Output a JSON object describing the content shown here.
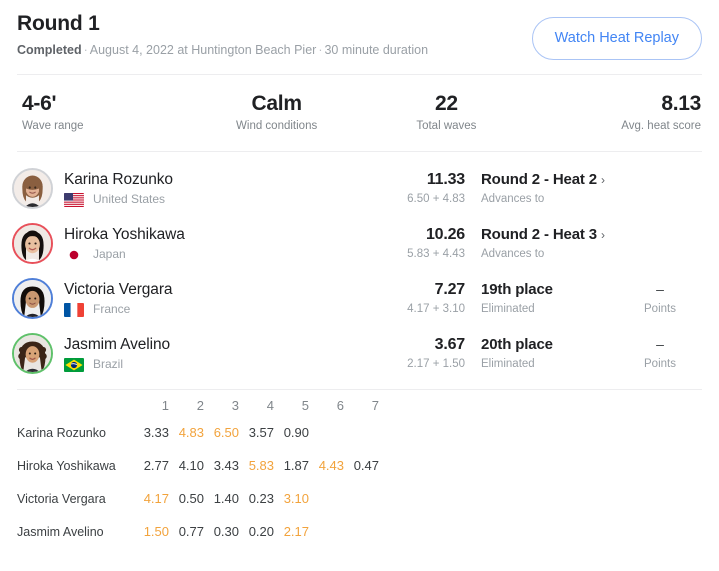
{
  "header": {
    "title": "Round 1",
    "status": "Completed",
    "separator": "·",
    "date_location": "August 4, 2022 at Huntington Beach Pier",
    "duration": "30 minute duration",
    "replay_button": "Watch Heat Replay",
    "accent_color": "#4285f4"
  },
  "stats": [
    {
      "value": "4-6'",
      "label": "Wave range"
    },
    {
      "value": "Calm",
      "label": "Wind conditions"
    },
    {
      "value": "22",
      "label": "Total waves"
    },
    {
      "value": "8.13",
      "label": "Avg. heat score"
    }
  ],
  "athletes": [
    {
      "name": "Karina Rozunko",
      "country": "United States",
      "flag": "us",
      "ring_color": "#d0d2d6",
      "total": "11.33",
      "parts": "6.50 + 4.83",
      "result": "Round 2 - Heat 2",
      "chevron": "›",
      "result_sub": "Advances to",
      "points": null,
      "points_label": null
    },
    {
      "name": "Hiroka Yoshikawa",
      "country": "Japan",
      "flag": "jp",
      "ring_color": "#e8505a",
      "total": "10.26",
      "parts": "5.83 + 4.43",
      "result": "Round 2 - Heat 3",
      "chevron": "›",
      "result_sub": "Advances to",
      "points": null,
      "points_label": null
    },
    {
      "name": "Victoria Vergara",
      "country": "France",
      "flag": "fr",
      "ring_color": "#4f7fd8",
      "total": "7.27",
      "parts": "4.17 + 3.10",
      "result": "19th place",
      "chevron": "",
      "result_sub": "Eliminated",
      "points": "–",
      "points_label": "Points"
    },
    {
      "name": "Jasmim Avelino",
      "country": "Brazil",
      "flag": "br",
      "ring_color": "#5fc16a",
      "total": "3.67",
      "parts": "2.17 + 1.50",
      "result": "20th place",
      "chevron": "",
      "result_sub": "Eliminated",
      "points": "–",
      "points_label": "Points"
    }
  ],
  "waves_table": {
    "name_header": "",
    "columns": [
      "1",
      "2",
      "3",
      "4",
      "5",
      "6",
      "7"
    ],
    "highlight_color": "#f2a33c",
    "rows": [
      {
        "athlete": "Karina Rozunko",
        "scores": [
          "3.33",
          "4.83",
          "6.50",
          "3.57",
          "0.90",
          "",
          ""
        ],
        "highlights": [
          false,
          true,
          true,
          false,
          false,
          false,
          false
        ]
      },
      {
        "athlete": "Hiroka Yoshikawa",
        "scores": [
          "2.77",
          "4.10",
          "3.43",
          "5.83",
          "1.87",
          "4.43",
          "0.47"
        ],
        "highlights": [
          false,
          false,
          false,
          true,
          false,
          true,
          false
        ]
      },
      {
        "athlete": "Victoria Vergara",
        "scores": [
          "4.17",
          "0.50",
          "1.40",
          "0.23",
          "3.10",
          "",
          ""
        ],
        "highlights": [
          true,
          false,
          false,
          false,
          true,
          false,
          false
        ]
      },
      {
        "athlete": "Jasmim Avelino",
        "scores": [
          "1.50",
          "0.77",
          "0.30",
          "0.20",
          "2.17",
          "",
          ""
        ],
        "highlights": [
          true,
          false,
          false,
          false,
          true,
          false,
          false
        ]
      }
    ]
  }
}
